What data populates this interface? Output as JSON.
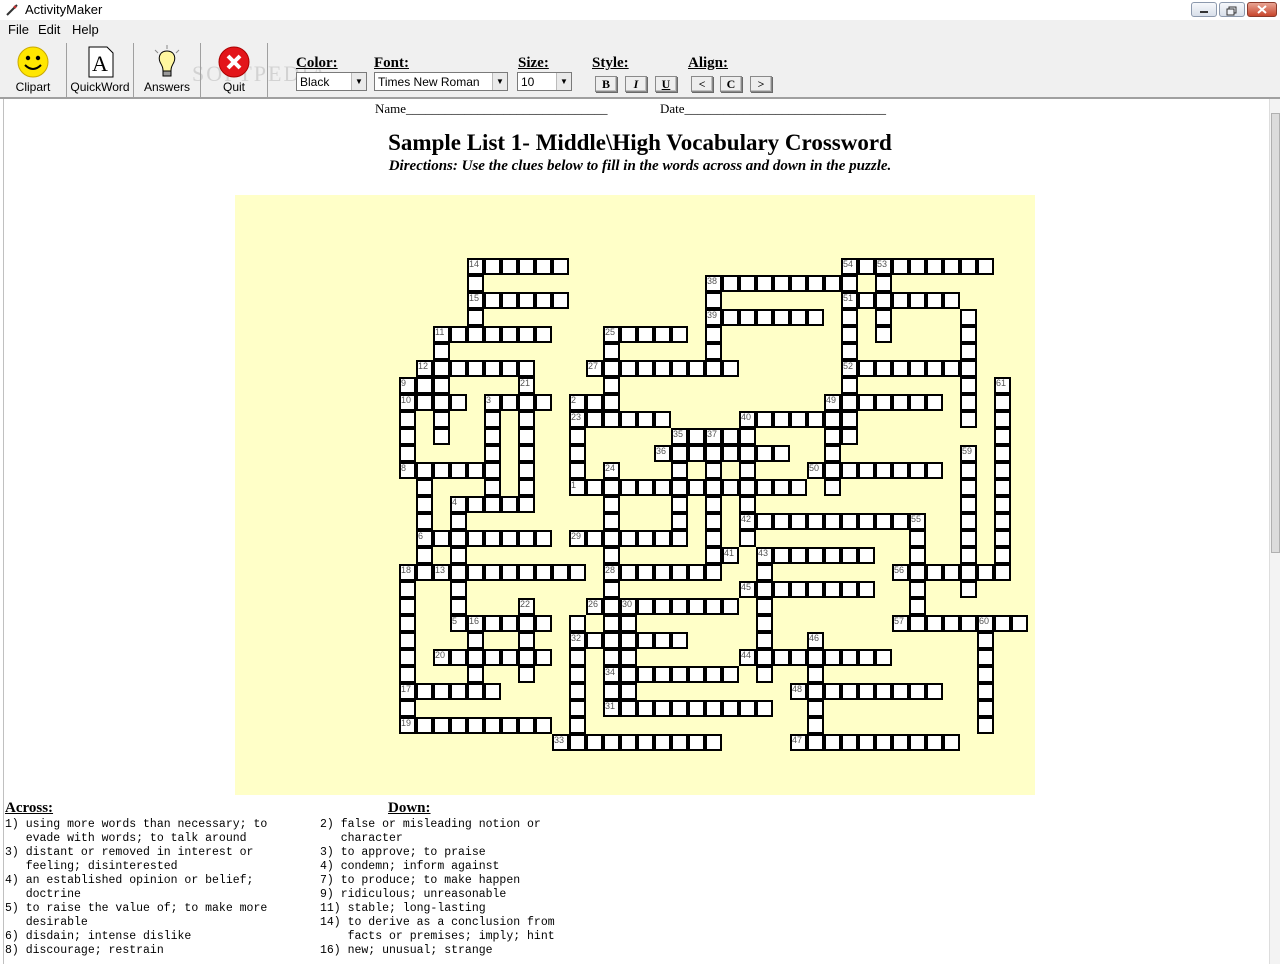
{
  "app": {
    "title": "ActivityMaker",
    "watermark": "SOFTPEDIA"
  },
  "menu": [
    "File",
    "Edit",
    "Help"
  ],
  "toolbar": {
    "buttons": [
      {
        "label": "Clipart",
        "icon": "smiley-icon"
      },
      {
        "label": "QuickWord",
        "icon": "letter-a-icon"
      },
      {
        "label": "Answers",
        "icon": "lightbulb-icon"
      },
      {
        "label": "Quit",
        "icon": "close-x-icon"
      }
    ],
    "color_label": "Color:",
    "color_value": "Black",
    "font_label": "Font:",
    "font_value": "Times New Roman",
    "size_label": "Size:",
    "size_value": "10",
    "style_label": "Style:",
    "style_buttons": [
      "B",
      "I",
      "U"
    ],
    "align_label": "Align:",
    "align_buttons": [
      "<",
      "C",
      ">"
    ]
  },
  "document": {
    "name_line": "Name_______________________________",
    "date_line": "Date_______________________________",
    "title": "Sample List 1- Middle\\High Vocabulary Crossword",
    "directions": "Directions: Use the clues below to fill in the words across and down in the puzzle.",
    "across_heading": "Across:",
    "down_heading": "Down:",
    "across_clues": "1) using more words than necessary; to\n   evade with words; to talk around\n3) distant or removed in interest or\n   feeling; disinterested\n4) an established opinion or belief;\n   doctrine\n5) to raise the value of; to make more\n   desirable\n6) disdain; intense dislike\n8) discourage; restrain",
    "down_clues": "2) false or misleading notion or\n   character\n3) to approve; to praise\n4) condemn; inform against\n7) to produce; to make happen\n9) ridiculous; unreasonable\n11) stable; long-lasting\n14) to derive as a conclusion from\n    facts or premises; imply; hint\n16) new; unusual; strange"
  },
  "colors": {
    "puzzle_background": "#ffffc8",
    "toolbar_background": "#f0f0f0"
  },
  "puzzle": {
    "cols": 47,
    "rows": 35,
    "across": [
      {
        "n": "14",
        "r": 2,
        "c": 9,
        "len": 6
      },
      {
        "n": "54",
        "r": 2,
        "c": 31,
        "len": 2
      },
      {
        "n": "53",
        "r": 2,
        "c": 33,
        "len": 7
      },
      {
        "n": "38",
        "r": 3,
        "c": 23,
        "len": 8
      },
      {
        "n": "15",
        "r": 4,
        "c": 9,
        "len": 6
      },
      {
        "n": "51",
        "r": 4,
        "c": 31,
        "len": 7
      },
      {
        "n": "39",
        "r": 5,
        "c": 23,
        "len": 7
      },
      {
        "n": "11",
        "r": 6,
        "c": 7,
        "len": 7
      },
      {
        "n": "25",
        "r": 6,
        "c": 17,
        "len": 5
      },
      {
        "n": "12",
        "r": 8,
        "c": 6,
        "len": 7
      },
      {
        "n": "27",
        "r": 8,
        "c": 16,
        "len": 9
      },
      {
        "n": "52",
        "r": 8,
        "c": 31,
        "len": 7
      },
      {
        "n": "9",
        "r": 9,
        "c": 5,
        "len": 2
      },
      {
        "n": "21",
        "r": 9,
        "c": 12,
        "len": 1
      },
      {
        "n": "61",
        "r": 9,
        "c": 40,
        "len": 1
      },
      {
        "n": "10",
        "r": 10,
        "c": 5,
        "len": 4
      },
      {
        "n": "3",
        "r": 10,
        "c": 10,
        "len": 4
      },
      {
        "n": "2",
        "r": 10,
        "c": 15,
        "len": 2
      },
      {
        "n": "49",
        "r": 10,
        "c": 30,
        "len": 7
      },
      {
        "n": "23",
        "r": 11,
        "c": 15,
        "len": 6
      },
      {
        "n": "40",
        "r": 11,
        "c": 25,
        "len": 5
      },
      {
        "n": "35",
        "r": 12,
        "c": 21,
        "len": 2
      },
      {
        "n": "37",
        "r": 12,
        "c": 23,
        "len": 2
      },
      {
        "n": "36",
        "r": 13,
        "c": 20,
        "len": 8
      },
      {
        "n": "59",
        "r": 13,
        "c": 38,
        "len": 1
      },
      {
        "n": "8",
        "r": 14,
        "c": 5,
        "len": 5
      },
      {
        "n": "24",
        "r": 14,
        "c": 17,
        "len": 1
      },
      {
        "n": "50",
        "r": 14,
        "c": 29,
        "len": 8
      },
      {
        "n": "1",
        "r": 15,
        "c": 15,
        "len": 14
      },
      {
        "n": "4",
        "r": 16,
        "c": 8,
        "len": 5
      },
      {
        "n": "42",
        "r": 17,
        "c": 25,
        "len": 10
      },
      {
        "n": "55",
        "r": 17,
        "c": 35,
        "len": 1
      },
      {
        "n": "6",
        "r": 18,
        "c": 6,
        "len": 8
      },
      {
        "n": "29",
        "r": 18,
        "c": 15,
        "len": 7
      },
      {
        "n": "41",
        "r": 19,
        "c": 24,
        "len": 1
      },
      {
        "n": "43",
        "r": 19,
        "c": 26,
        "len": 7
      },
      {
        "n": "18",
        "r": 20,
        "c": 5,
        "len": 1
      },
      {
        "n": "13",
        "r": 20,
        "c": 7,
        "len": 9
      },
      {
        "n": "28",
        "r": 20,
        "c": 17,
        "len": 7
      },
      {
        "n": "56",
        "r": 20,
        "c": 34,
        "len": 7
      },
      {
        "n": "45",
        "r": 21,
        "c": 25,
        "len": 8
      },
      {
        "n": "22",
        "r": 22,
        "c": 12,
        "len": 1
      },
      {
        "n": "26",
        "r": 22,
        "c": 16,
        "len": 2
      },
      {
        "n": "30",
        "r": 22,
        "c": 18,
        "len": 7
      },
      {
        "n": "5",
        "r": 23,
        "c": 8,
        "len": 6
      },
      {
        "n": "16",
        "r": 23,
        "c": 9,
        "len": 0
      },
      {
        "n": "57",
        "r": 23,
        "c": 34,
        "len": 5
      },
      {
        "n": "60",
        "r": 23,
        "c": 39,
        "len": 3
      },
      {
        "n": "32",
        "r": 24,
        "c": 15,
        "len": 7
      },
      {
        "n": "46",
        "r": 24,
        "c": 29,
        "len": 1
      },
      {
        "n": "20",
        "r": 25,
        "c": 7,
        "len": 7
      },
      {
        "n": "44",
        "r": 25,
        "c": 25,
        "len": 9
      },
      {
        "n": "34",
        "r": 26,
        "c": 17,
        "len": 8
      },
      {
        "n": "17",
        "r": 27,
        "c": 5,
        "len": 6
      },
      {
        "n": "48",
        "r": 27,
        "c": 28,
        "len": 9
      },
      {
        "n": "31",
        "r": 28,
        "c": 17,
        "len": 10
      },
      {
        "n": "19",
        "r": 29,
        "c": 5,
        "len": 9
      },
      {
        "n": "33",
        "r": 30,
        "c": 14,
        "len": 10
      },
      {
        "n": "47",
        "r": 30,
        "c": 28,
        "len": 10
      }
    ],
    "down": [
      {
        "r": 2,
        "c": 9,
        "len": 4
      },
      {
        "r": 2,
        "c": 33,
        "len": 5
      },
      {
        "r": 2,
        "c": 31,
        "len": 11
      },
      {
        "r": 3,
        "c": 23,
        "len": 5
      },
      {
        "r": 5,
        "c": 38,
        "len": 7
      },
      {
        "r": 6,
        "c": 7,
        "len": 7
      },
      {
        "r": 6,
        "c": 17,
        "len": 5
      },
      {
        "r": 9,
        "c": 5,
        "len": 6
      },
      {
        "r": 9,
        "c": 12,
        "len": 7
      },
      {
        "r": 9,
        "c": 40,
        "len": 12
      },
      {
        "r": 10,
        "c": 10,
        "len": 7
      },
      {
        "r": 10,
        "c": 15,
        "len": 6
      },
      {
        "r": 10,
        "c": 30,
        "len": 6
      },
      {
        "r": 11,
        "c": 25,
        "len": 8
      },
      {
        "r": 12,
        "c": 21,
        "len": 7
      },
      {
        "r": 12,
        "c": 23,
        "len": 8
      },
      {
        "r": 13,
        "c": 38,
        "len": 9
      },
      {
        "r": 14,
        "c": 6,
        "len": 7
      },
      {
        "r": 14,
        "c": 17,
        "len": 15
      },
      {
        "r": 16,
        "c": 8,
        "len": 8
      },
      {
        "r": 17,
        "c": 35,
        "len": 7
      },
      {
        "r": 19,
        "c": 26,
        "len": 8
      },
      {
        "r": 20,
        "c": 5,
        "len": 10
      },
      {
        "r": 22,
        "c": 12,
        "len": 5
      },
      {
        "r": 22,
        "c": 16,
        "len": 0
      },
      {
        "r": 22,
        "c": 18,
        "len": 7
      },
      {
        "r": 23,
        "c": 9,
        "len": 5
      },
      {
        "r": 23,
        "c": 15,
        "len": 7
      },
      {
        "r": 23,
        "c": 39,
        "len": 7
      },
      {
        "r": 24,
        "c": 29,
        "len": 7
      }
    ]
  }
}
